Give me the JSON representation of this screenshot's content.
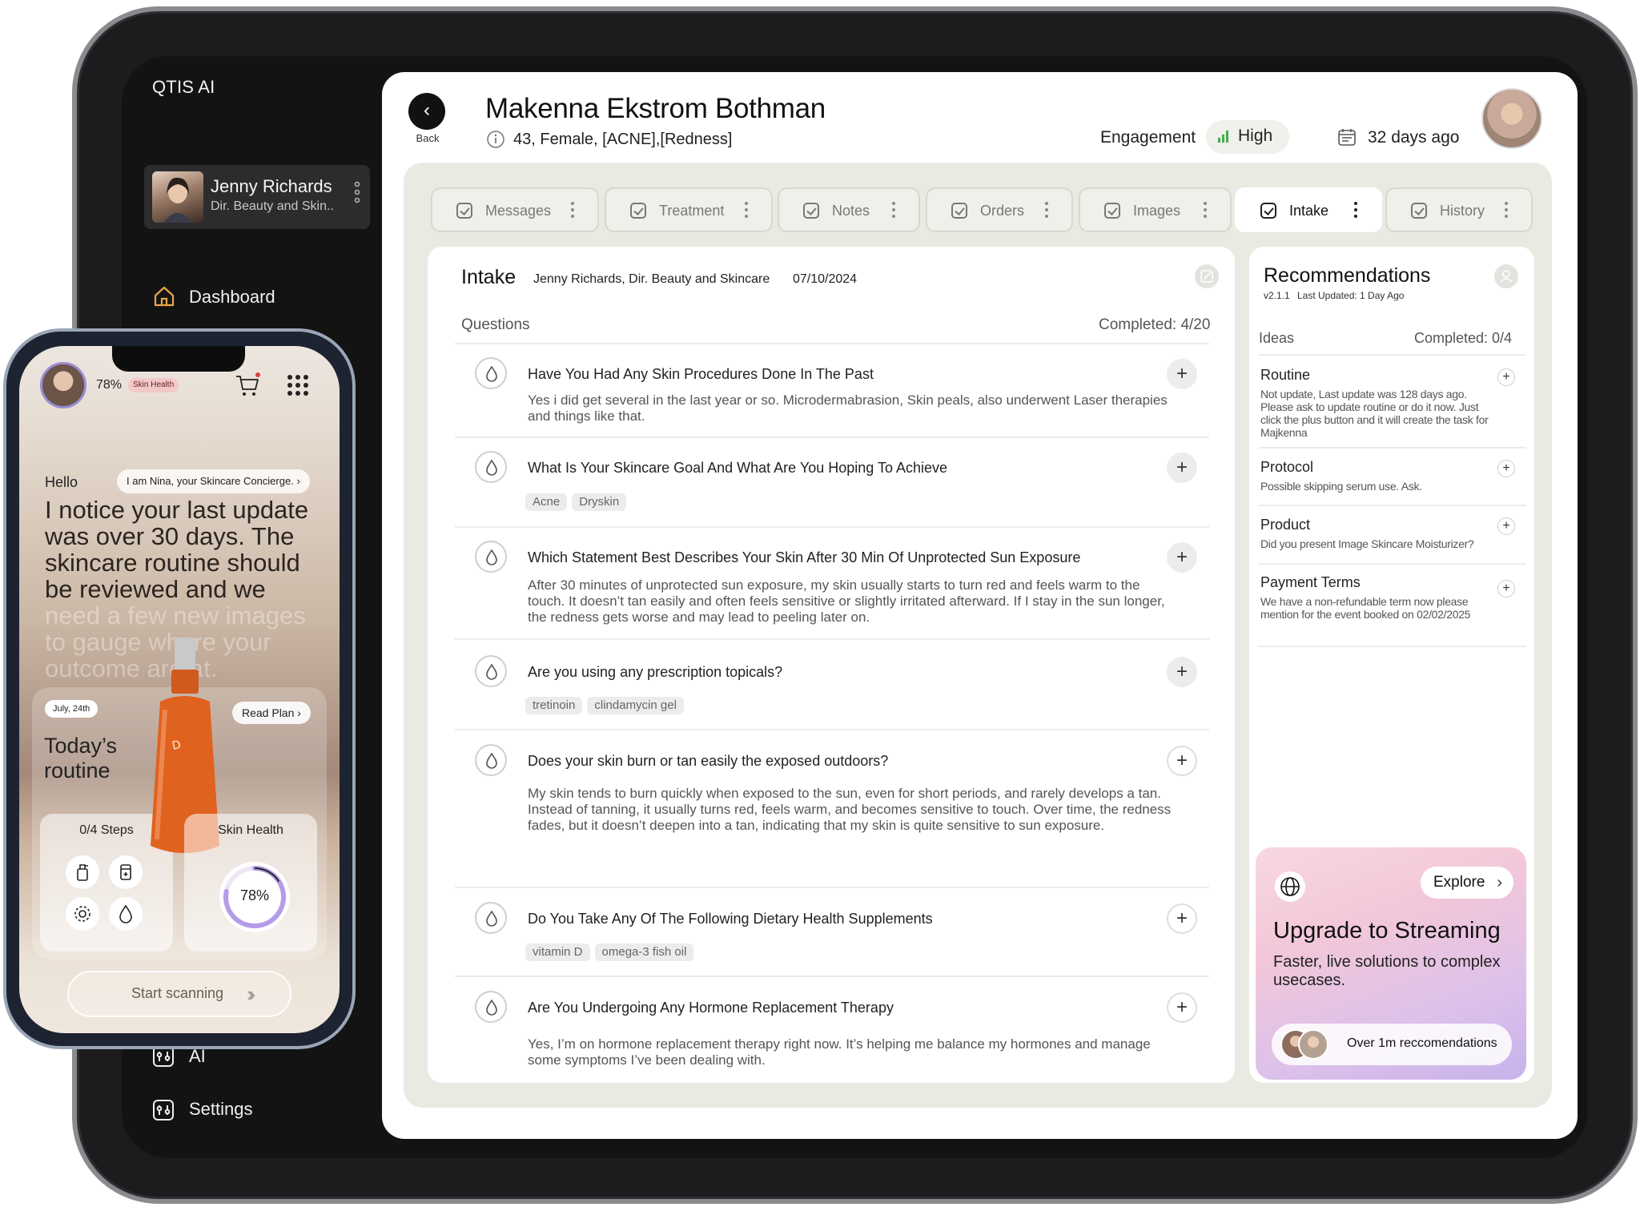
{
  "sidebar": {
    "brand": "QTIS AI",
    "profile": {
      "name": "Jenny Richards",
      "role": "Dir. Beauty and Skin.."
    },
    "nav": {
      "dashboard": "Dashboard",
      "ai": "AI",
      "settings": "Settings"
    }
  },
  "header": {
    "back_label": "Back",
    "patient_name": "Makenna Ekstrom Bothman",
    "patient_info": "43, Female, [ACNE],[Redness]",
    "engagement_label": "Engagement",
    "engagement_value": "High",
    "last_seen": "32 days ago"
  },
  "tabs": [
    {
      "label": "Messages"
    },
    {
      "label": "Treatment"
    },
    {
      "label": "Notes"
    },
    {
      "label": "Orders"
    },
    {
      "label": "Images"
    },
    {
      "label": "Intake"
    },
    {
      "label": "History"
    }
  ],
  "active_tab": "Intake",
  "intake": {
    "title": "Intake",
    "author": "Jenny Richards, Dir. Beauty and Skincare",
    "date": "07/10/2024",
    "questions_label": "Questions",
    "completed": "Completed: 4/20",
    "questions": [
      {
        "q": "Have You Had Any Skin Procedures Done In The Past",
        "a": "Yes i did get several in the last year or so. Microdermabrasion, Skin peals, also underwent Laser therapies and things like that."
      },
      {
        "q": "What Is Your Skincare Goal And What Are You Hoping To Achieve",
        "chips": [
          "Acne",
          "Dryskin"
        ]
      },
      {
        "q": "Which Statement Best Describes Your Skin After 30 Min Of Unprotected Sun Exposure",
        "a": "After 30 minutes of unprotected sun exposure, my skin usually starts to turn red and feels warm to the touch. It doesn’t tan easily and often feels sensitive or slightly irritated afterward. If I stay in the sun longer, the redness gets worse and may lead to peeling later on."
      },
      {
        "q": "Are you using any prescription topicals?",
        "chips": [
          "tretinoin",
          "clindamycin gel"
        ]
      },
      {
        "q": "Does your skin burn or tan easily the exposed outdoors?",
        "a": "My skin tends to burn quickly when exposed to the sun, even for short periods, and rarely develops a tan. Instead of tanning, it usually turns red, feels warm, and becomes sensitive to touch. Over time, the redness fades, but it doesn’t deepen into a tan, indicating that my skin is quite sensitive to sun exposure."
      },
      {
        "q": "Do You Take Any Of The Following Dietary Health Supplements",
        "chips": [
          "vitamin D",
          "omega-3 fish oil"
        ]
      },
      {
        "q": "Are You Undergoing Any Hormone Replacement Therapy",
        "a": "Yes, I’m on hormone replacement therapy right now. It’s helping me balance my hormones and manage some symptoms I’ve been dealing with."
      }
    ]
  },
  "recommendations": {
    "title": "Recommendations",
    "version": "v2.1.1",
    "updated": "Last Updated: 1 Day Ago",
    "ideas_label": "Ideas",
    "completed": "Completed: 0/4",
    "items": [
      {
        "title": "Routine",
        "text": "Not update, Last update was 128 days ago. Please ask to update routine or do it now. Just click the plus button and it will create the task for Majkenna"
      },
      {
        "title": "Protocol",
        "text": "Possible skipping serum use. Ask."
      },
      {
        "title": "Product",
        "text": "Did you present Image Skincare Moisturizer?"
      },
      {
        "title": "Payment Terms",
        "text": "We have a non-refundable term now please mention for the event booked on 02/02/2025"
      }
    ]
  },
  "upgrade": {
    "explore": "Explore",
    "title": "Upgrade to Streaming",
    "desc": "Faster, live solutions to complex usecases.",
    "pill": "Over 1m reccomendations"
  },
  "phone": {
    "percent": "78%",
    "badge": "Skin Health",
    "hello": "Hello",
    "concierge": "I am Nina, your Skincare Concierge.",
    "message_visible": "I notice your last update was over 30 days. The skincare routine should be reviewed and we",
    "message_faded": "need a few new images to gauge where your outcome are at.",
    "routine_date": "July, 24th",
    "read_plan": "Read Plan",
    "routine_title": "Today’s routine",
    "steps": "0/4 Steps",
    "health_label": "Skin Health",
    "health_value": "78%",
    "health_fraction": 0.78,
    "scan": "Start scanning"
  },
  "colors": {
    "accent_green": "#3fae4a",
    "badge_red": "#f3c8c8",
    "ring_purple": "#b49ce8"
  }
}
